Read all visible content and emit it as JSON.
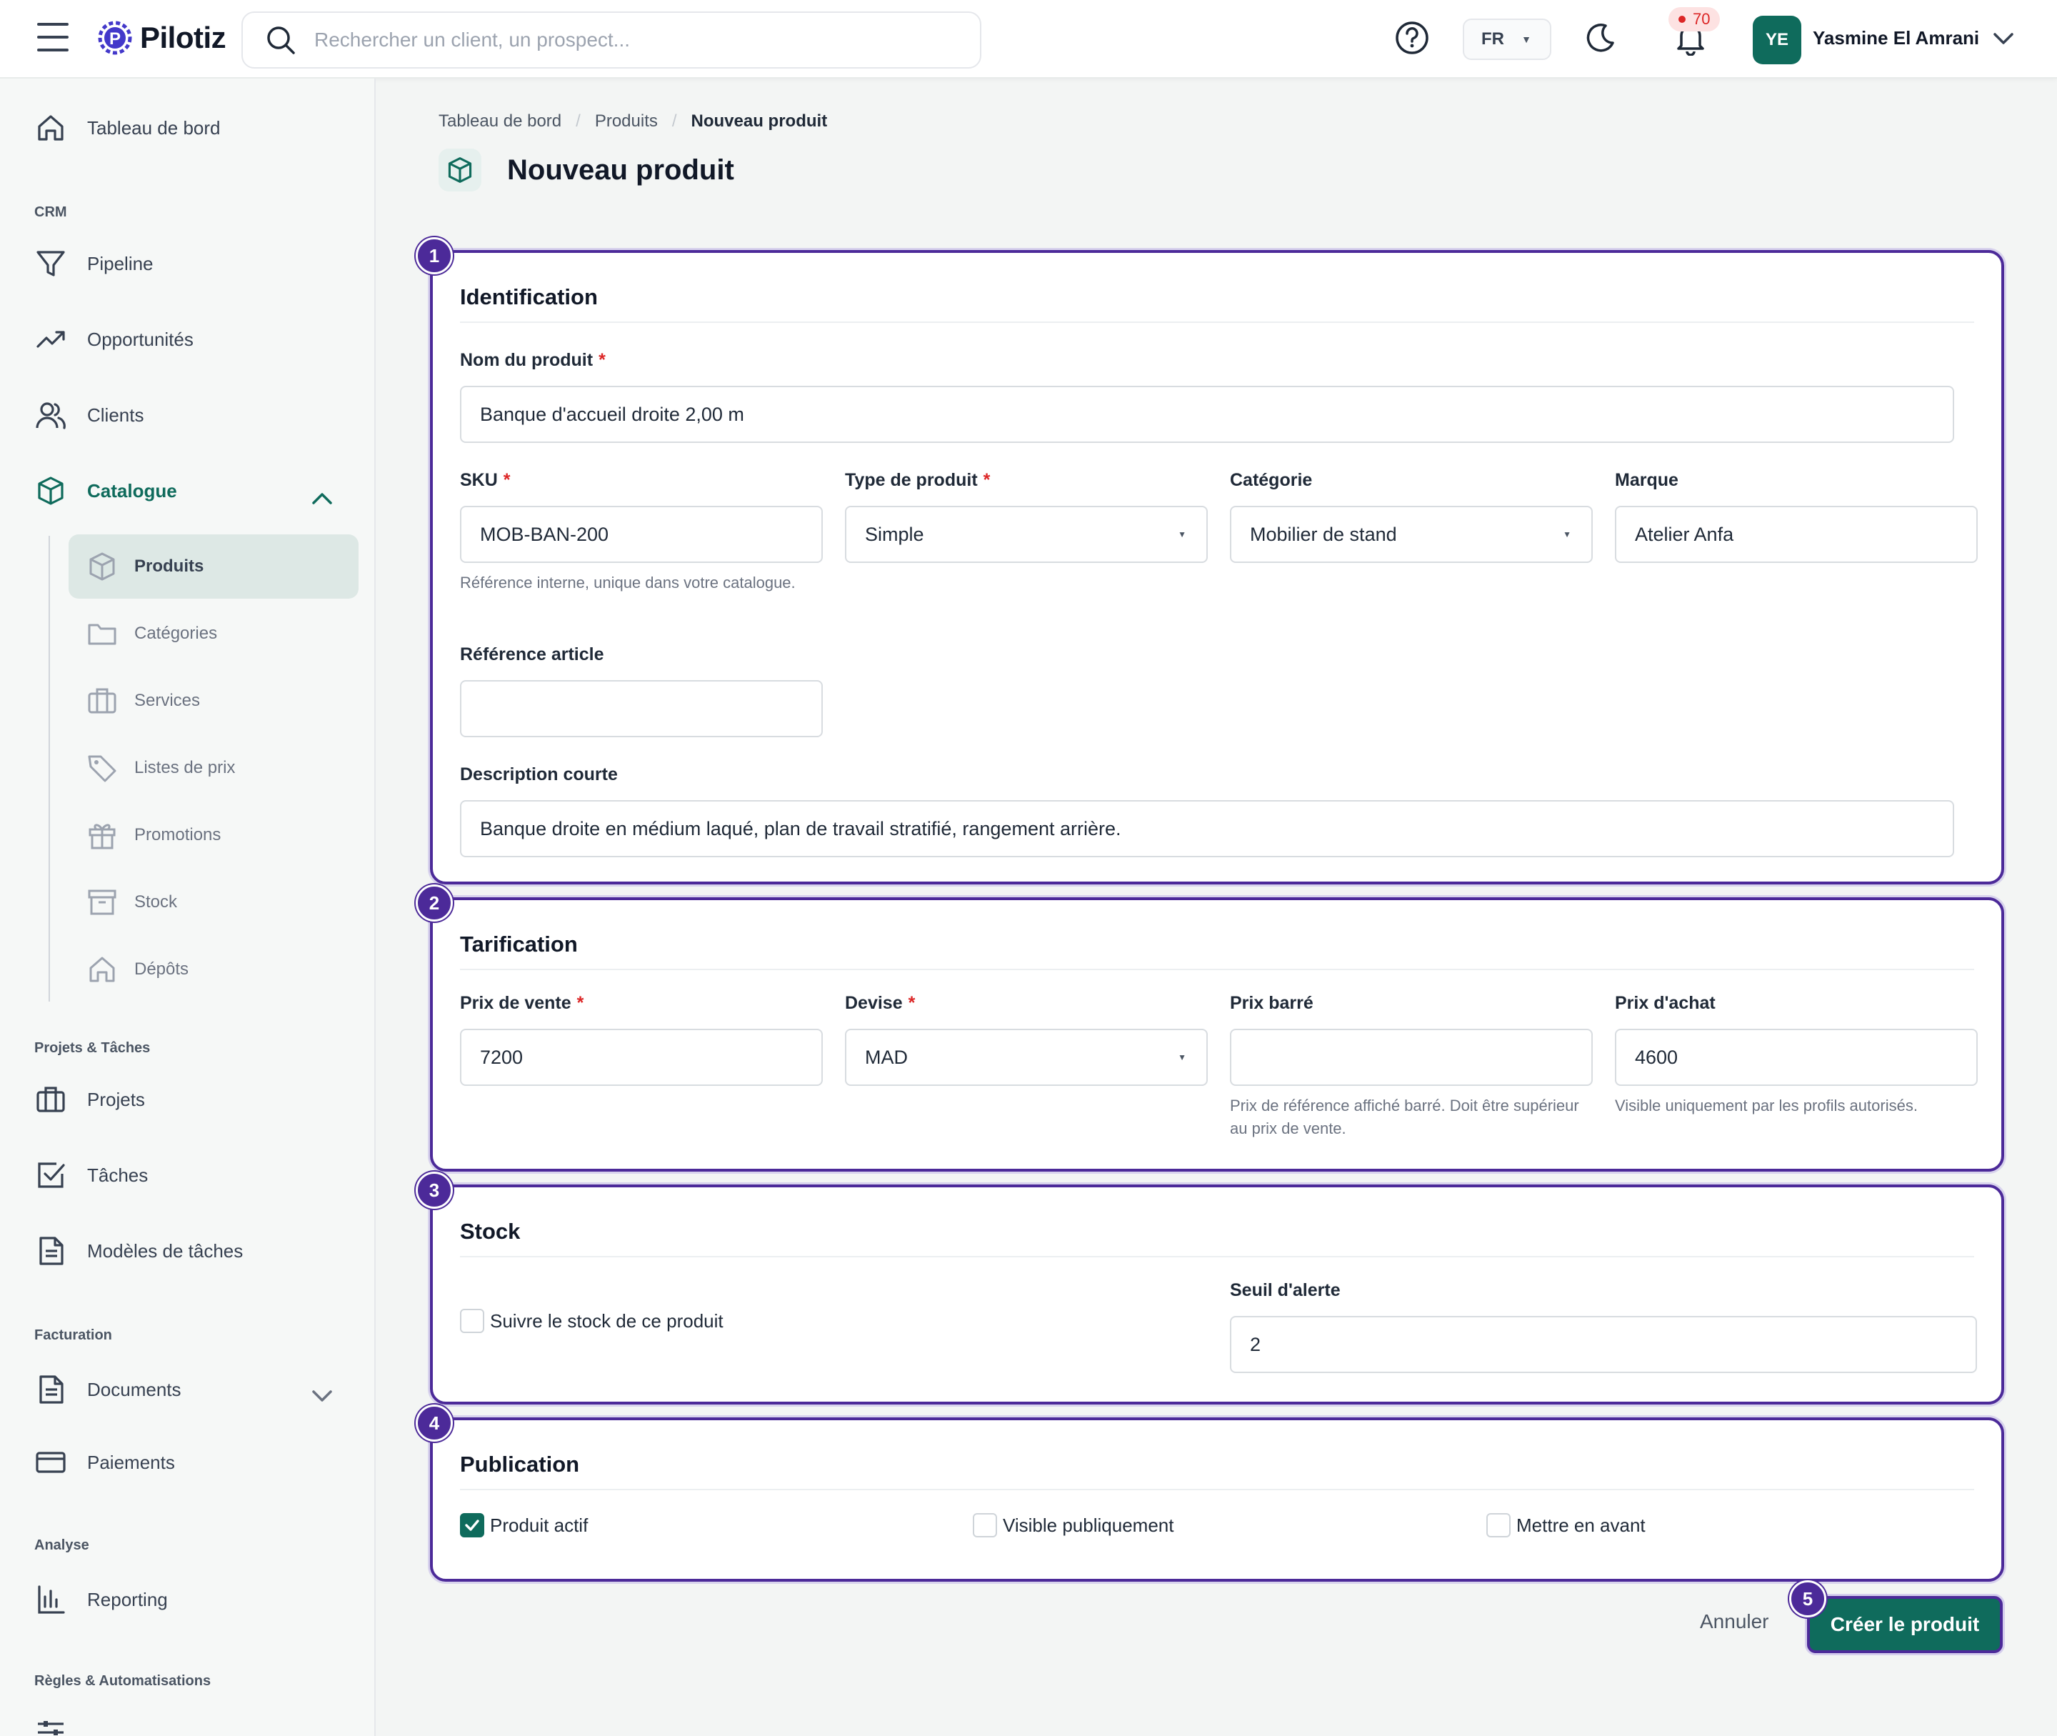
{
  "header": {
    "app_name": "Pilotiz",
    "search_placeholder": "Rechercher un client, un prospect...",
    "language": "FR",
    "notification_count": "70",
    "user_initials": "YE",
    "user_name": "Yasmine El Amrani"
  },
  "sidebar": {
    "dashboard": "Tableau de bord",
    "section_crm": "CRM",
    "pipeline": "Pipeline",
    "opportunities": "Opportunités",
    "clients": "Clients",
    "catalogue": "Catalogue",
    "catalogue_children": {
      "products": "Produits",
      "categories": "Catégories",
      "services": "Services",
      "price_lists": "Listes de prix",
      "promotions": "Promotions",
      "stock": "Stock",
      "depots": "Dépôts"
    },
    "section_projects": "Projets & Tâches",
    "projects": "Projets",
    "tasks": "Tâches",
    "task_templates": "Modèles de tâches",
    "section_billing": "Facturation",
    "documents": "Documents",
    "payments": "Paiements",
    "section_analysis": "Analyse",
    "reporting": "Reporting",
    "section_rules": "Règles & Automatisations"
  },
  "breadcrumb": {
    "home": "Tableau de bord",
    "section": "Produits",
    "current": "Nouveau produit"
  },
  "page": {
    "title": "Nouveau produit"
  },
  "identification": {
    "step": "1",
    "title": "Identification",
    "name_label": "Nom du produit",
    "name_value": "Banque d'accueil droite 2,00 m",
    "sku_label": "SKU",
    "sku_value": "MOB-BAN-200",
    "sku_help": "Référence interne, unique dans votre catalogue.",
    "type_label": "Type de produit",
    "type_value": "Simple",
    "category_label": "Catégorie",
    "category_value": "Mobilier de stand",
    "brand_label": "Marque",
    "brand_value": "Atelier Anfa",
    "reference_label": "Référence article",
    "reference_value": "",
    "short_desc_label": "Description courte",
    "short_desc_value": "Banque droite en médium laqué, plan de travail stratifié, rangement arrière."
  },
  "pricing": {
    "step": "2",
    "title": "Tarification",
    "sale_price_label": "Prix de vente",
    "sale_price_value": "7200",
    "currency_label": "Devise",
    "currency_value": "MAD",
    "strike_price_label": "Prix barré",
    "strike_price_value": "",
    "strike_price_help": "Prix de référence affiché barré. Doit être supérieur au prix de vente.",
    "purchase_price_label": "Prix d'achat",
    "purchase_price_value": "4600",
    "purchase_price_help": "Visible uniquement par les profils autorisés."
  },
  "stock": {
    "step": "3",
    "title": "Stock",
    "track_label": "Suivre le stock de ce produit",
    "track_checked": false,
    "alert_label": "Seuil d'alerte",
    "alert_value": "2"
  },
  "publication": {
    "step": "4",
    "title": "Publication",
    "active_label": "Produit actif",
    "active_checked": true,
    "public_label": "Visible publiquement",
    "public_checked": false,
    "featured_label": "Mettre en avant",
    "featured_checked": false
  },
  "actions": {
    "step": "5",
    "cancel": "Annuler",
    "create": "Créer le produit"
  },
  "colors": {
    "brand": "#0f6b5c",
    "highlight": "#4c2a99",
    "required": "#dc2626"
  }
}
